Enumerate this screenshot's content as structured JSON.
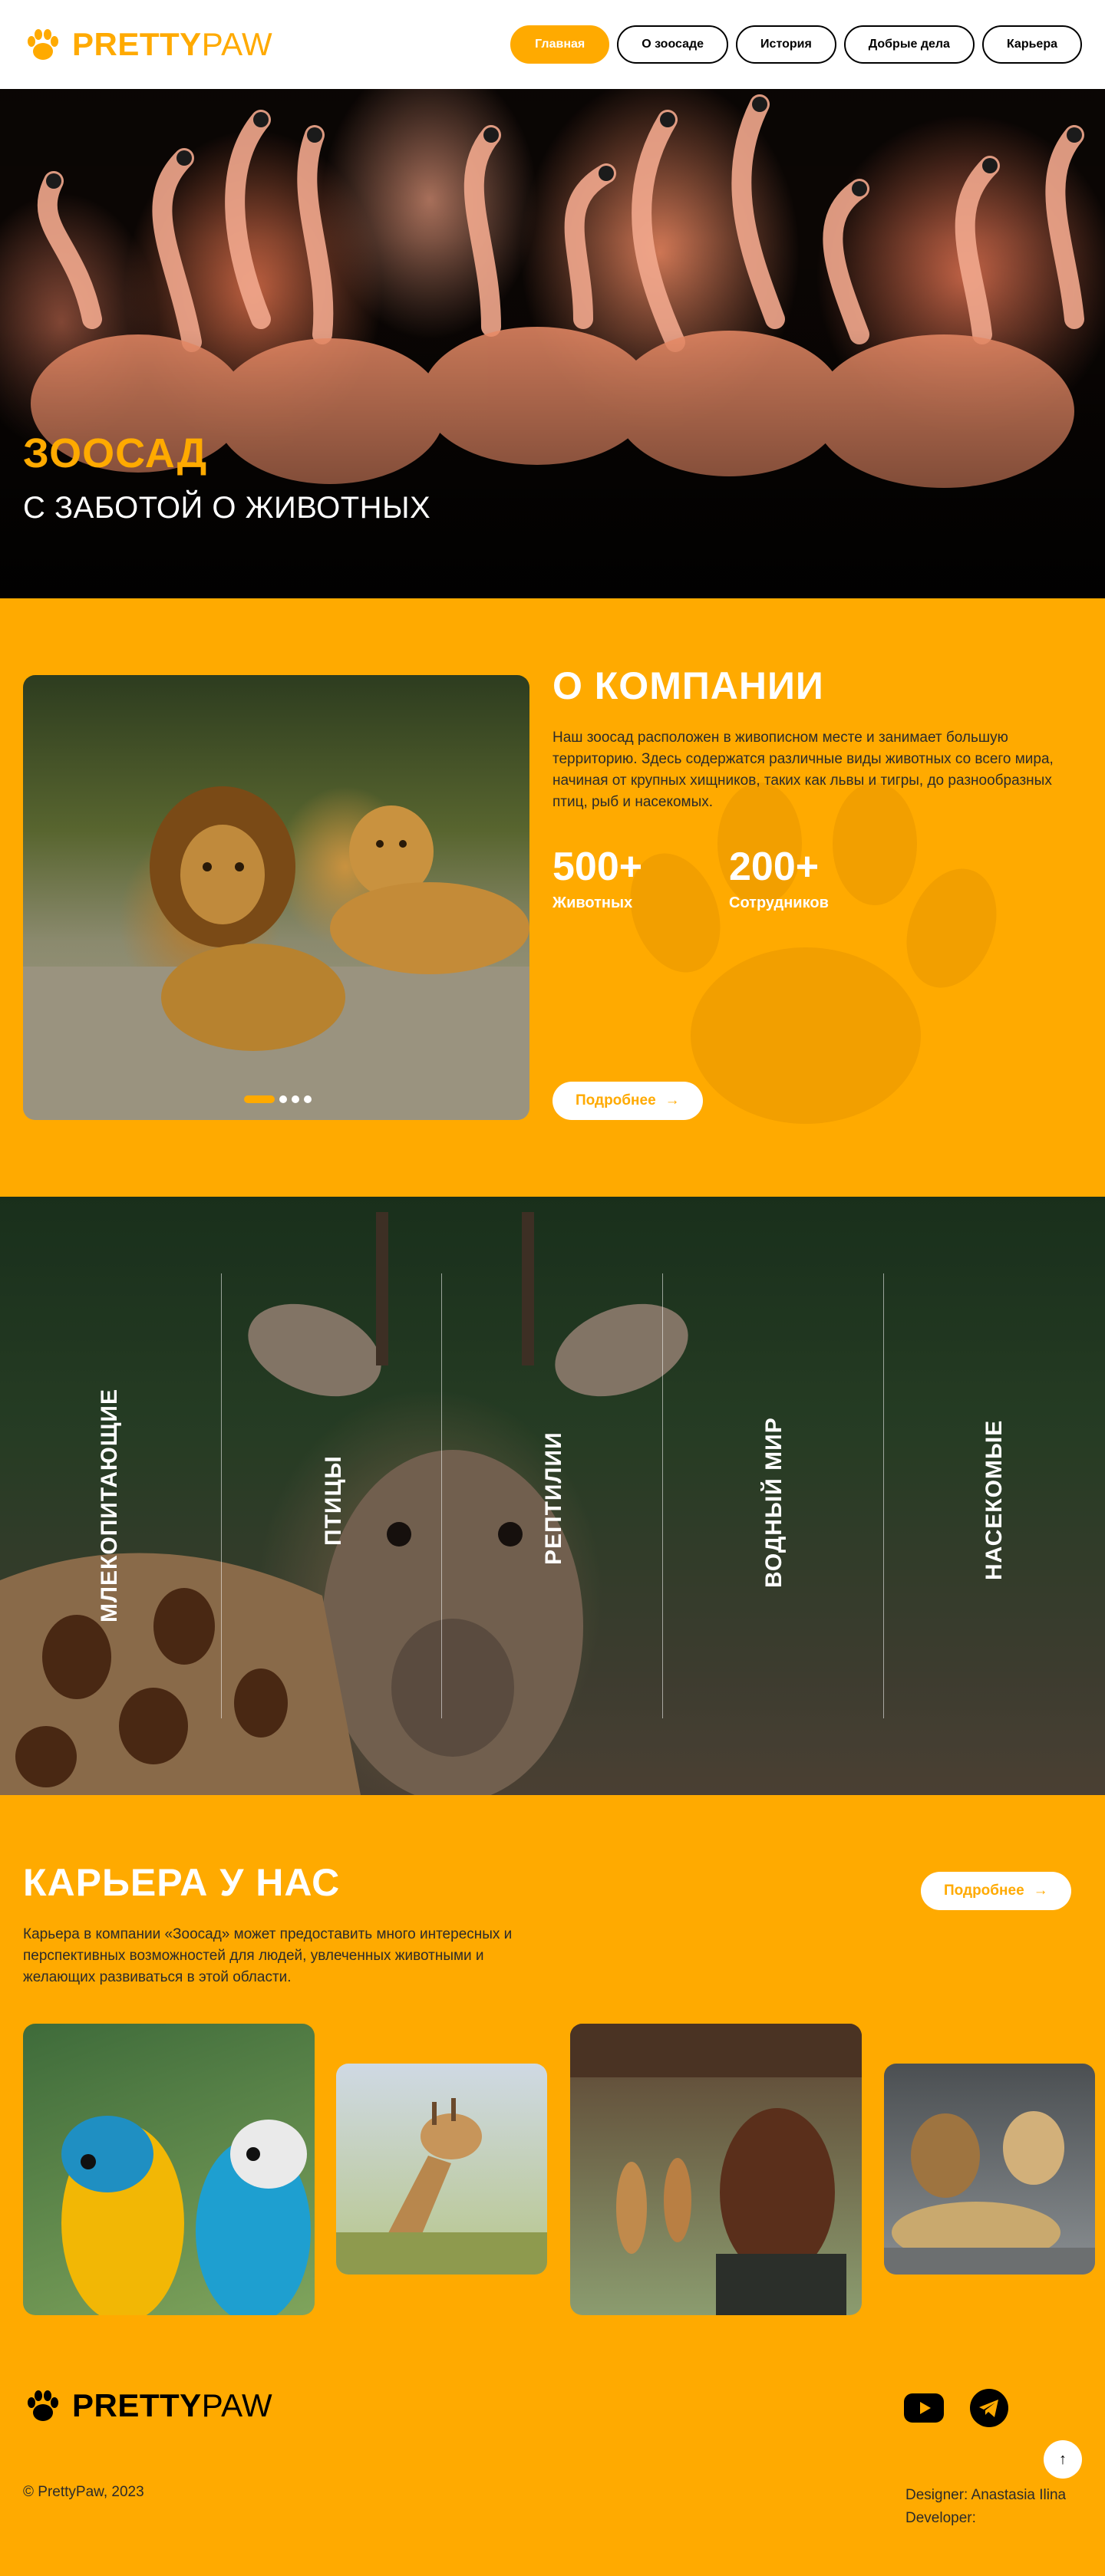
{
  "brand": {
    "bold": "PRETTY",
    "light": "PAW"
  },
  "nav": [
    {
      "label": "Главная",
      "active": true
    },
    {
      "label": "О зоосаде",
      "active": false
    },
    {
      "label": "История",
      "active": false
    },
    {
      "label": "Добрые дела",
      "active": false
    },
    {
      "label": "Карьера",
      "active": false
    }
  ],
  "hero": {
    "title": "ЗООСАД",
    "subtitle": "С ЗАБОТОЙ О ЖИВОТНЫХ"
  },
  "about": {
    "title": "О КОМПАНИИ",
    "text": "Наш зоосад расположен в живописном месте и занимает большую территорию. Здесь содержатся различные виды животных со всего мира, начиная от крупных хищников, таких как львы и тигры, до разнообразных птиц, рыб и насекомых.",
    "stats": [
      {
        "value": "500+",
        "label": "Животных"
      },
      {
        "value": "200+",
        "label": "Сотрудников"
      }
    ],
    "button": "Подробнее",
    "slider_dots": 4,
    "slider_active": 1
  },
  "categories": [
    "МЛЕКОПИТАЮЩИЕ",
    "ПТИЦЫ",
    "РЕПТИЛИИ",
    "ВОДНЫЙ МИР",
    "НАСЕКОМЫЕ"
  ],
  "career": {
    "title": "КАРЬЕРА У НАС",
    "text": "Карьера в компании «Зоосад» может предоставить много интересных и перспективных возможностей для людей, увлеченных животными и желающих развиваться в этой области.",
    "button": "Подробнее",
    "photos": [
      "parrots-photo",
      "giraffe-photo",
      "visitor-photo",
      "lions-photo"
    ]
  },
  "footer": {
    "copyright": "© PrettyPaw, 2023",
    "designer": "Designer: Anastasia Ilina",
    "developer": "Developer:",
    "social": [
      "youtube-icon",
      "telegram-icon"
    ]
  },
  "colors": {
    "accent": "#FFAA00",
    "dark": "#000000",
    "light": "#FFFFFF"
  }
}
